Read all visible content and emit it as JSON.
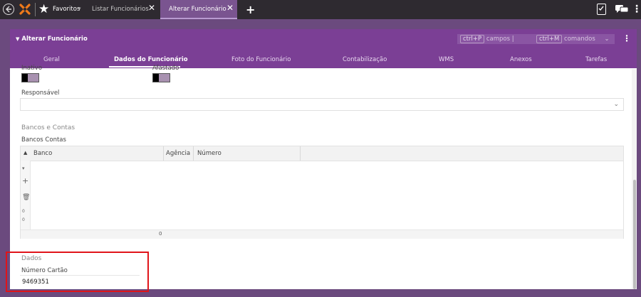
{
  "topbar": {
    "favorites_label": "Favoritos",
    "tabs": [
      {
        "label": "Listar Funcionários",
        "close": "✕"
      },
      {
        "label": "Alterar Funcionário",
        "close": "✕"
      }
    ],
    "new_tab": "+",
    "icons": [
      "back-arrow-icon",
      "logo-icon",
      "star-icon",
      "clipboard-check-icon",
      "chat-icon",
      "more-vertical-icon"
    ]
  },
  "panel": {
    "title": "Alterar Funcionário",
    "shortcut_fields_key": "ctrl+P",
    "shortcut_fields_label": "campos",
    "shortcut_sep": "|",
    "shortcut_commands_key": "ctrl+M",
    "shortcut_commands_label": "comandos",
    "subtabs": [
      "Geral",
      "Dados do Funcionário",
      "Foto do Funcionário",
      "Contabilização",
      "WMS",
      "Anexos",
      "Tarefas"
    ],
    "active_subtab": "Dados do Funcionário"
  },
  "form": {
    "toggle1_label": "Inativo",
    "toggle2_label": "Afastado",
    "responsavel_label": "Responsável",
    "responsavel_value": "",
    "banks_section": "Bancos e Contas",
    "banks_field_label": "Bancos Contas",
    "grid": {
      "columns": [
        "Banco",
        "Agência",
        "Número"
      ],
      "rows": [],
      "count": "0",
      "side_numbers": [
        "0",
        "0"
      ]
    },
    "dados_section": "Dados",
    "numero_cartao_label": "Número Cartão",
    "numero_cartao_value": "9469351"
  },
  "colors": {
    "topbar": "#2e2a30",
    "accent": "#7b3f95",
    "highlight": "#e0141a"
  }
}
